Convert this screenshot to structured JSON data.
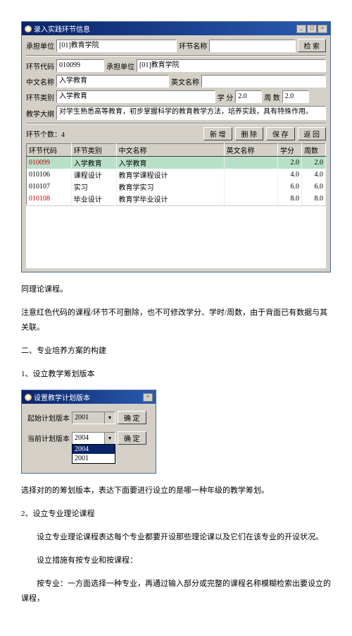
{
  "win1": {
    "title": "录入实践环节信息",
    "top": {
      "dept_label": "承担单位",
      "dept_value": "[01]教育学院",
      "segname_label": "环节名称",
      "segname_value": "",
      "search_btn": "检 索"
    },
    "form": {
      "code_label": "环节代码",
      "code_value": "010099",
      "dept2_label": "承担单位",
      "dept2_value": "[01]教育学院",
      "cnname_label": "中文名称",
      "cnname_value": "入学教育",
      "enname_label": "英文名称",
      "enname_value": "",
      "type_label": "环节类别",
      "type_value": "入学教育",
      "credit_label": "学 分",
      "credit_value": "2.0",
      "weeks_label": "周 数",
      "weeks_value": "2.0",
      "outline_label": "教学大纲",
      "outline_value": "对学生熟悉高等教育，初步掌握科学的教育教学方法，培养实践，具有特殊作用。"
    },
    "count_label": "环节个数：4",
    "btns": {
      "add": "新 增",
      "del": "删 除",
      "save": "保 存",
      "back": "返 回"
    },
    "table": {
      "headers": [
        "环节代码",
        "环节类别",
        "中文名称",
        "英文名称",
        "学分",
        "周数"
      ],
      "rows": [
        {
          "code": "010099",
          "cat": "入学教育",
          "cn": "入学教育",
          "en": "",
          "credit": "2.0",
          "weeks": "2.0",
          "hl": true,
          "red": true
        },
        {
          "code": "010106",
          "cat": "课程设计",
          "cn": "教育学课程设计",
          "en": "",
          "credit": "4.0",
          "weeks": "4.0",
          "hl": false,
          "red": false
        },
        {
          "code": "010107",
          "cat": "实习",
          "cn": "教育学实习",
          "en": "",
          "credit": "6.0",
          "weeks": "6.0",
          "hl": false,
          "red": false
        },
        {
          "code": "010108",
          "cat": "毕业设计",
          "cn": "教育学毕业设计",
          "en": "",
          "credit": "8.0",
          "weeks": "8.0",
          "hl": false,
          "red": true
        }
      ]
    }
  },
  "doc1": {
    "p1": "同理论课程。",
    "p2": "注意红色代码的课程/环节不可删除，也不可修改学分、学时/周数，由于背面已有数据与其关联。",
    "h2": "二、专业培养方案的构建",
    "s1": "1、设立教学筹划版本"
  },
  "win2": {
    "title": "设置教学计划版本",
    "start_label": "起始计划版本",
    "start_value": "2001",
    "cur_label": "当前计划版本",
    "cur_value": "2004",
    "opt1": "2004",
    "opt2": "2001",
    "ok": "确 定"
  },
  "doc2": {
    "p3": "选择对的的筹划版本，表达下面要进行设立的是哪一种年级的教学筹划。",
    "s2": "2、设立专业理论课程",
    "p4": "设立专业理论课程表达每个专业都要开设那些理论课以及它们在该专业的开设状况。",
    "p5": "设立措施有按专业和按课程：",
    "p6": "按专业：一方面选择一种专业，再通过输入部分或完整的课程名称模糊检索出要设立的课程，"
  }
}
